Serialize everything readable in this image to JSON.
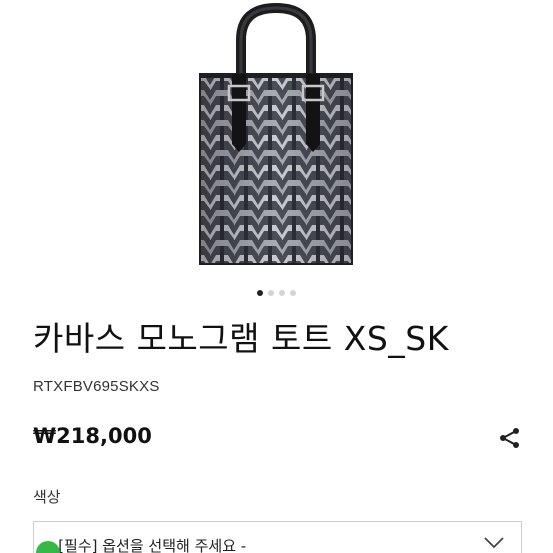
{
  "product": {
    "title": "카바스 모노그램 토트 XS_SK",
    "sku": "RTXFBV695SKXS",
    "price": "₩218,000",
    "image_icon": "tote-bag-product-image"
  },
  "gallery": {
    "slide_count": 4,
    "active_slide": 1
  },
  "options": {
    "label": "색상",
    "select_value": "- [필수] 옵션을 선택해 주세요 -"
  },
  "icons": {
    "share": "share-icon",
    "chevron": "chevron-down-icon"
  },
  "colors": {
    "text": "#111111",
    "dot_active": "#222222",
    "dot_inactive": "#d4d4d4",
    "border": "#cfcfcf",
    "accent_green": "#39b54a"
  }
}
